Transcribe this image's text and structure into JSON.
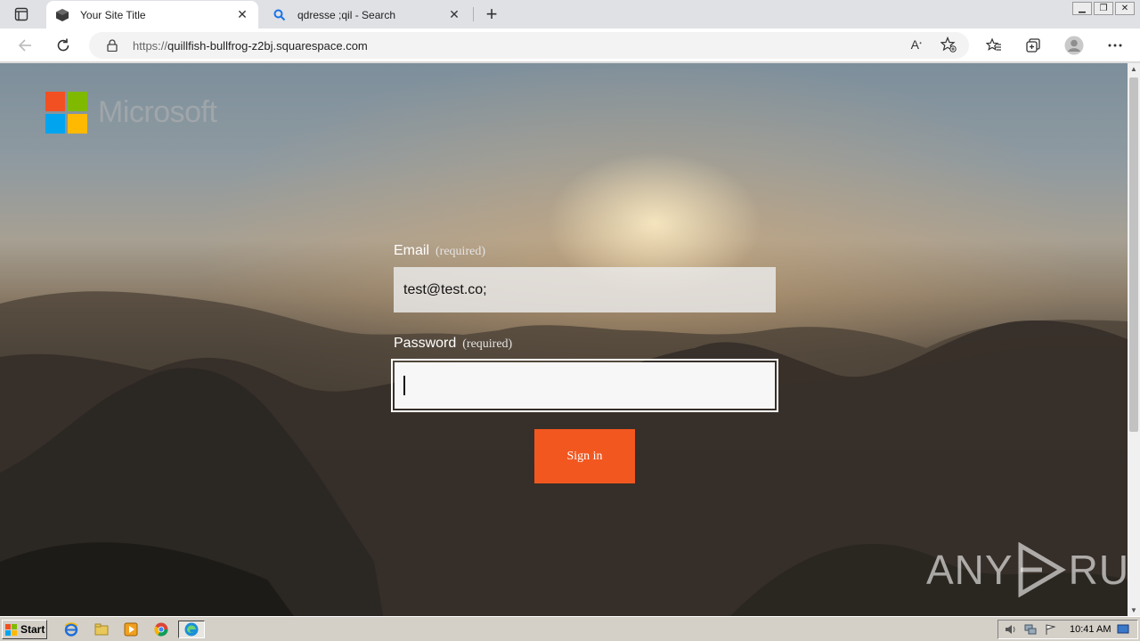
{
  "browser": {
    "tabs": [
      {
        "title": "Your Site Title",
        "icon": "cube-icon",
        "active": true
      },
      {
        "title": "qdresse ;qil - Search",
        "icon": "search-icon",
        "active": false
      }
    ],
    "new_tab_label": "+",
    "address": {
      "scheme": "https://",
      "host": "quillfish-bullfrog-z2bj.squarespace.com"
    }
  },
  "page": {
    "brand": "Microsoft",
    "email_label": "Email",
    "email_required": "(required)",
    "email_value": "test@test.co;",
    "password_label": "Password",
    "password_required": "(required)",
    "password_value": "",
    "sign_in_label": "Sign in",
    "watermark": "ANY RUN",
    "colors": {
      "sign_in_button": "#f2571f",
      "ms_red": "#f25022",
      "ms_green": "#7fba00",
      "ms_blue": "#00a4ef",
      "ms_yellow": "#ffb900"
    }
  },
  "taskbar": {
    "start_label": "Start",
    "apps": [
      "ie-icon",
      "explorer-icon",
      "media-player-icon",
      "chrome-icon",
      "edge-icon"
    ],
    "clock": "10:41 AM"
  }
}
